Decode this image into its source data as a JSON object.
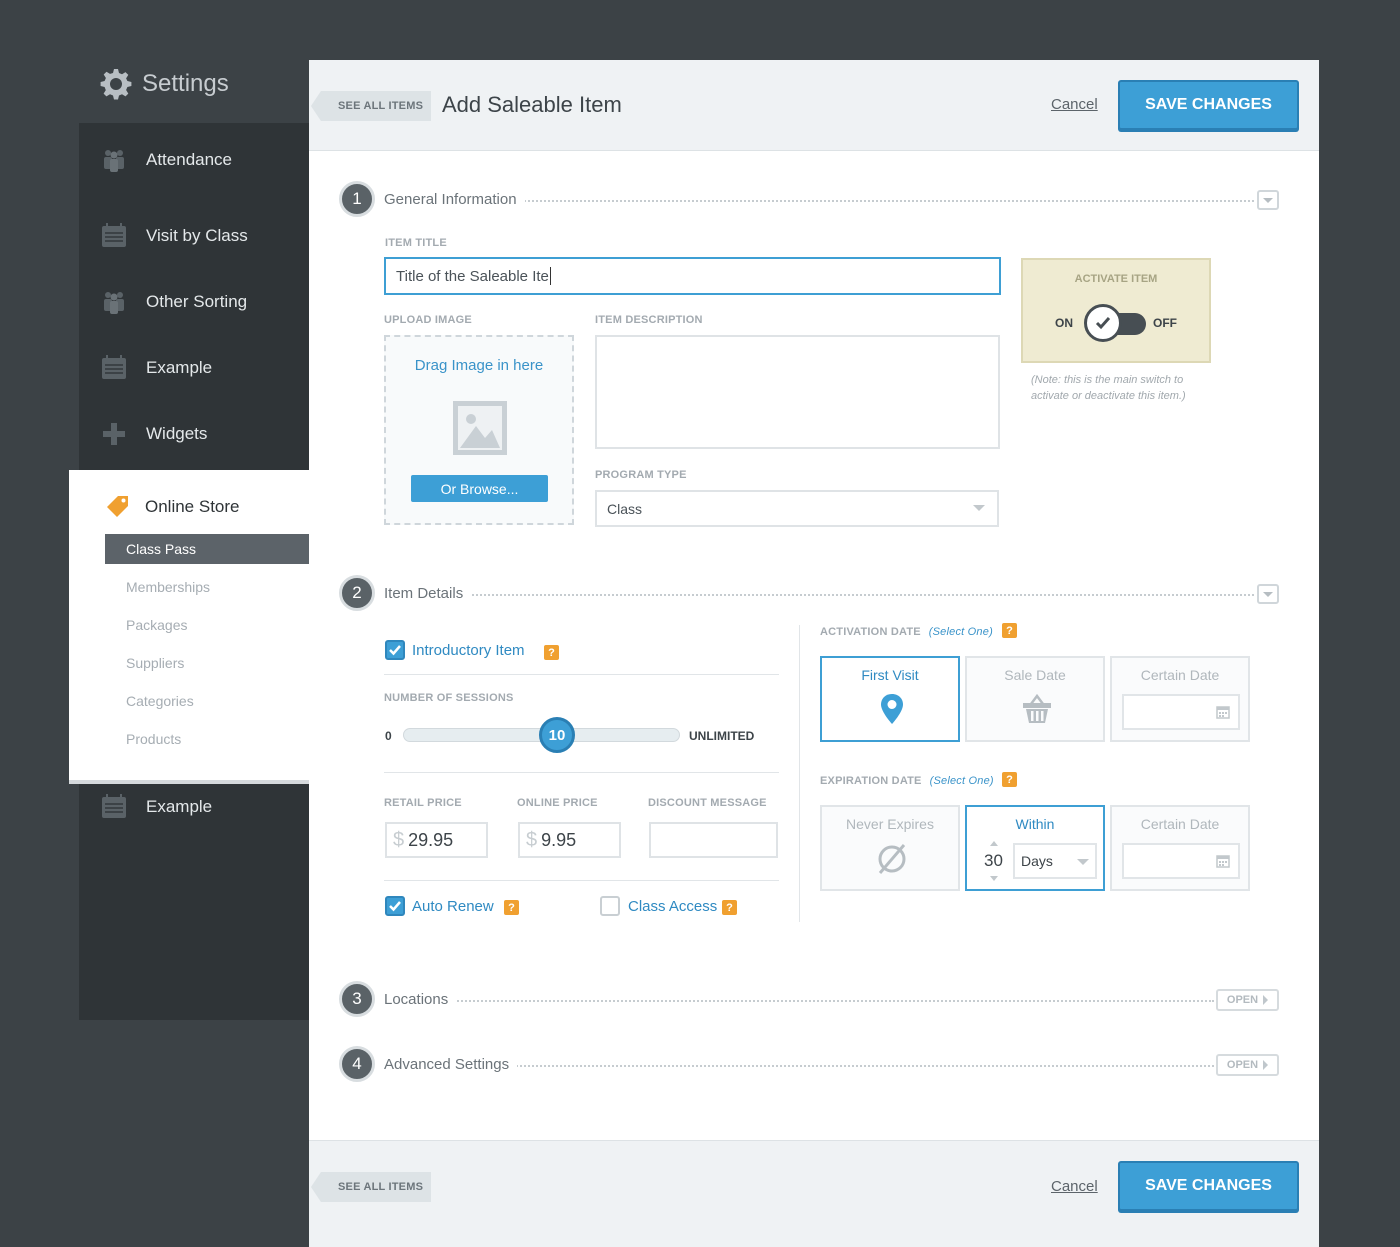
{
  "sidebar": {
    "title": "Settings",
    "items": [
      {
        "label": "Attendance",
        "icon": "people-icon"
      },
      {
        "label": "Visit by Class",
        "icon": "calendar-icon"
      },
      {
        "label": "Other Sorting",
        "icon": "people-icon"
      },
      {
        "label": "Example",
        "icon": "calendar-icon"
      },
      {
        "label": "Widgets",
        "icon": "plus-icon"
      }
    ],
    "store": {
      "label": "Online Store",
      "sub_items": [
        "Class Pass",
        "Memberships",
        "Packages",
        "Suppliers",
        "Categories",
        "Products"
      ],
      "active": "Class Pass"
    },
    "bottom_item": {
      "label": "Example",
      "icon": "calendar-icon"
    }
  },
  "header": {
    "see_all": "SEE ALL ITEMS",
    "title": "Add Saleable Item",
    "cancel": "Cancel",
    "save": "SAVE CHANGES"
  },
  "sections": [
    {
      "num": "1",
      "title": "General Information"
    },
    {
      "num": "2",
      "title": "Item Details"
    },
    {
      "num": "3",
      "title": "Locations",
      "action": "OPEN"
    },
    {
      "num": "4",
      "title": "Advanced Settings",
      "action": "OPEN"
    }
  ],
  "general": {
    "item_title_label": "ITEM TITLE",
    "item_title_value": "Title of the Saleable Ite",
    "upload_label": "UPLOAD IMAGE",
    "upload_drag": "Drag Image in here",
    "upload_browse": "Or Browse...",
    "description_label": "ITEM DESCRIPTION",
    "description_value": "",
    "program_type_label": "PROGRAM TYPE",
    "program_type_value": "Class",
    "activate_label": "ACTIVATE ITEM",
    "activate_on": "ON",
    "activate_off": "OFF",
    "activate_state": "on",
    "activate_note": "(Note: this is the main switch to activate or deactivate this item.)"
  },
  "details": {
    "introductory_label": "Introductory Item",
    "introductory_checked": true,
    "sessions_label": "NUMBER OF SESSIONS",
    "sessions_min": "0",
    "sessions_max": "UNLIMITED",
    "sessions_value": "10",
    "retail_label": "RETAIL PRICE",
    "retail_value": "29.95",
    "online_label": "ONLINE PRICE",
    "online_value": "9.95",
    "discount_label": "DISCOUNT MESSAGE",
    "discount_value": "",
    "currency": "$",
    "auto_renew_label": "Auto Renew",
    "auto_renew_checked": true,
    "class_access_label": "Class Access",
    "class_access_checked": false,
    "help": "?",
    "activation_label": "ACTIVATION DATE",
    "activation_hint": "(Select One)",
    "activation_options": [
      "First Visit",
      "Sale Date",
      "Certain Date"
    ],
    "activation_selected": "First Visit",
    "expiration_label": "EXPIRATION DATE",
    "expiration_hint": "(Select One)",
    "expiration_options": [
      "Never Expires",
      "Within",
      "Certain Date"
    ],
    "expiration_selected": "Within",
    "within_value": "30",
    "within_unit": "Days"
  },
  "footer": {
    "see_all": "SEE ALL ITEMS",
    "cancel": "Cancel",
    "save": "SAVE CHANGES"
  },
  "colors": {
    "accent": "#3d9fd6",
    "sidebar_bg": "#2f3437",
    "page_bg": "#3c4246",
    "help_badge": "#f0a030",
    "activate_bg": "#efebd2"
  }
}
